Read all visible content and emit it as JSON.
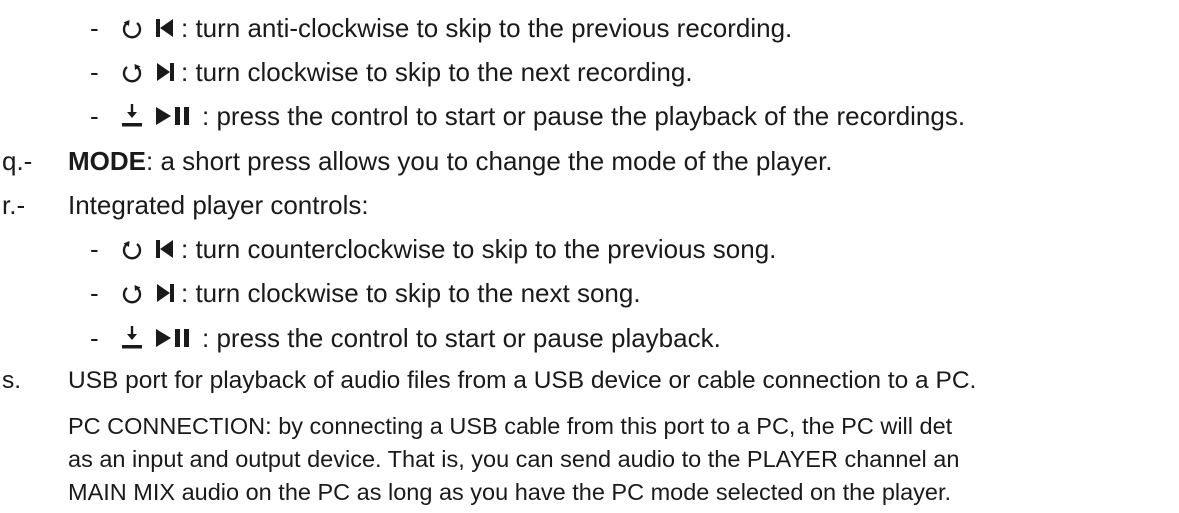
{
  "items": {
    "p_prev": {
      "dash": "-",
      "text": ": turn anti-clockwise to skip to the previous recording."
    },
    "p_next": {
      "dash": "-",
      "text": ": turn clockwise to skip to the next recording."
    },
    "p_play": {
      "dash": "-",
      "text": ": press the control to start or pause the playback of the recordings."
    },
    "q": {
      "marker": "q.-",
      "label": "MODE",
      "text": ": a short press allows you to change the mode of the player."
    },
    "r": {
      "marker": "r.-",
      "text": "Integrated player controls:"
    },
    "r_prev": {
      "dash": "-",
      "text": ": turn counterclockwise to skip to the previous song."
    },
    "r_next": {
      "dash": "-",
      "text": ": turn clockwise to skip to the next song."
    },
    "r_play": {
      "dash": "-",
      "text": ": press the control to start or pause playback."
    },
    "s": {
      "marker": "s.",
      "text": "USB port for playback of audio files from a USB device or cable connection to a PC."
    },
    "s_para": {
      "line1": "PC CONNECTION: by connecting a USB cable from this port to a PC, the PC will det",
      "line2": "as an input and output device. That is, you can send audio to the PLAYER channel an",
      "line3": "MAIN MIX audio on the PC as long as you have the PC mode selected on the player."
    }
  },
  "icons": {
    "ccw": "rotate-anticlockwise-icon",
    "cw": "rotate-clockwise-icon",
    "prev": "skip-previous-icon",
    "next": "skip-next-icon",
    "press": "press-down-icon",
    "play_pause": "play-pause-icon"
  }
}
